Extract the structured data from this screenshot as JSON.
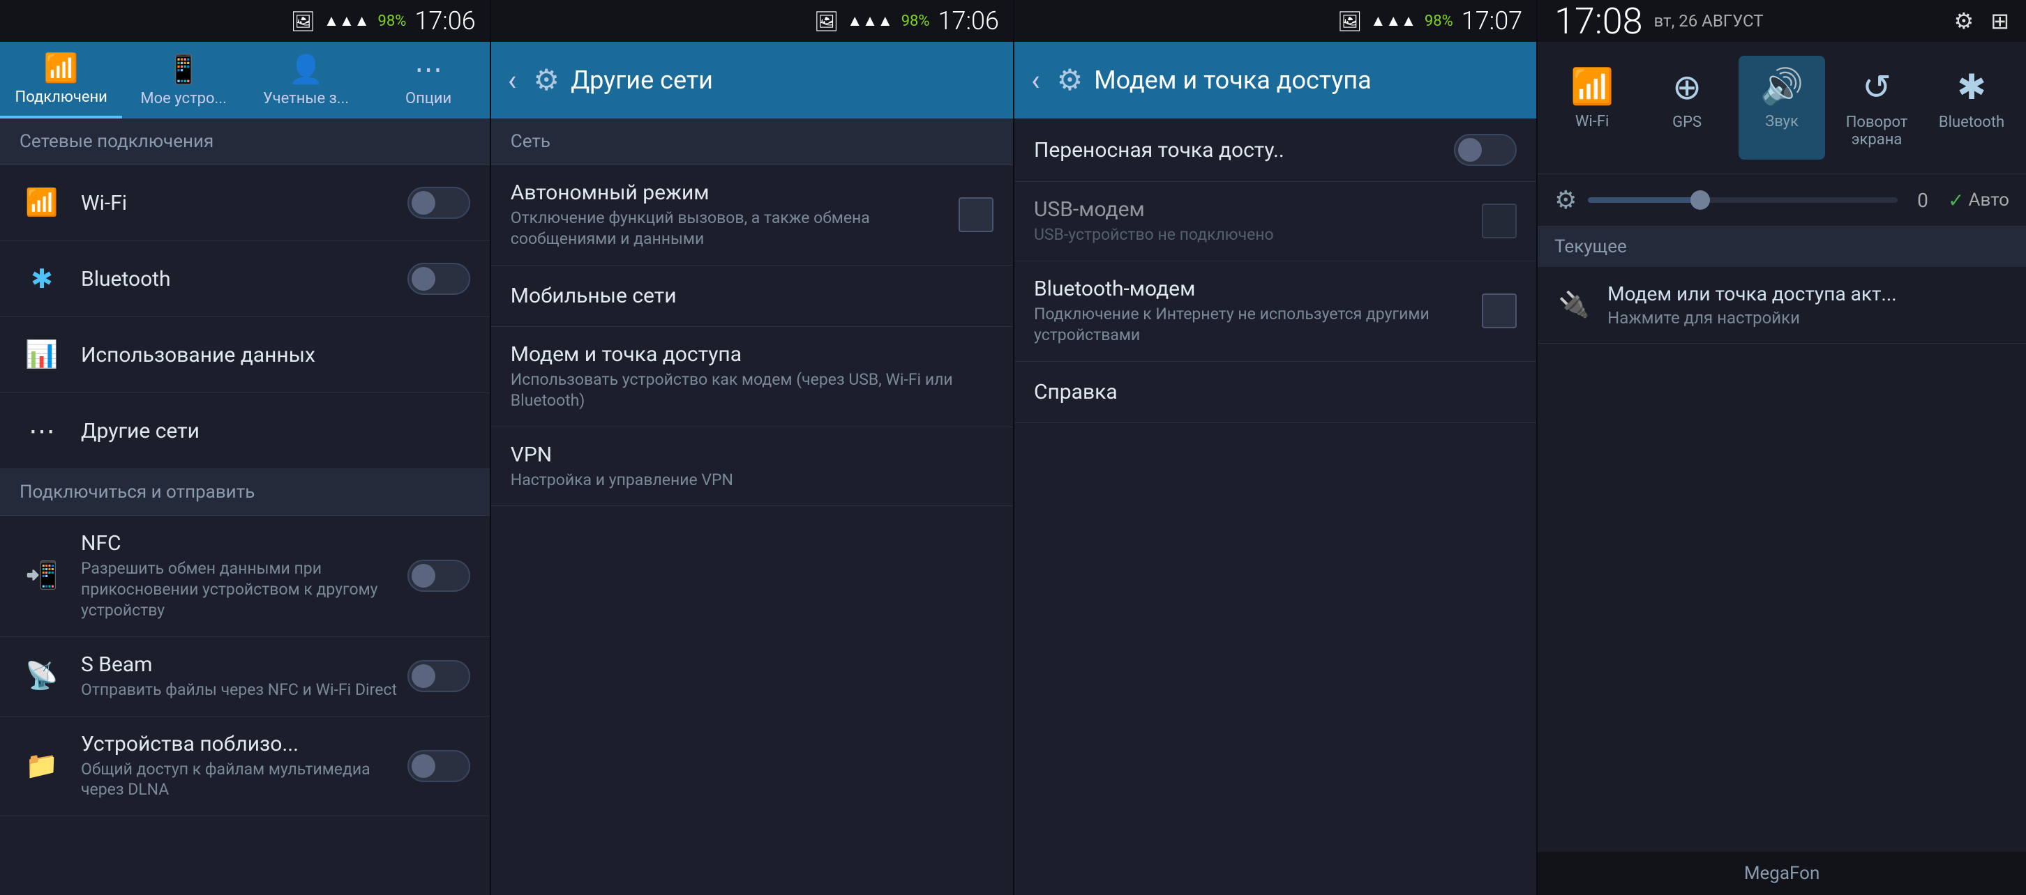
{
  "panel1": {
    "status": {
      "signal": "▲▲▲",
      "battery_pct": "98%",
      "time": "17:06",
      "image_icon": "🖼"
    },
    "tabs": [
      {
        "id": "connections",
        "label": "Подключени",
        "icon": "📶",
        "active": true
      },
      {
        "id": "mydevice",
        "label": "Мое устро...",
        "icon": "📱",
        "active": false
      },
      {
        "id": "accounts",
        "label": "Учетные з...",
        "icon": "👤",
        "active": false
      },
      {
        "id": "options",
        "label": "Опции",
        "icon": "⋯",
        "active": false
      }
    ],
    "section1": "Сетевые подключения",
    "items": [
      {
        "id": "wifi",
        "icon": "📶",
        "title": "Wi-Fi",
        "toggle": true,
        "toggle_state": "off"
      },
      {
        "id": "bluetooth",
        "icon": "🔵",
        "title": "Bluetooth",
        "toggle": true,
        "toggle_state": "off"
      }
    ],
    "section2": "Подключиться и отправить",
    "items2": [
      {
        "id": "data-usage",
        "icon": "📊",
        "title": "Использование данных",
        "toggle": false
      },
      {
        "id": "other-networks",
        "icon": "⋯",
        "title": "Другие сети",
        "toggle": false
      },
      {
        "id": "nfc",
        "icon": "📲",
        "title": "NFC",
        "subtitle": "Разрешить обмен данными при прикосновении устройством к другому устройству",
        "toggle": true,
        "toggle_state": "off"
      },
      {
        "id": "sbeam",
        "icon": "📡",
        "title": "S Beam",
        "subtitle": "Отправить файлы через NFC и Wi-Fi Direct",
        "toggle": true,
        "toggle_state": "off"
      },
      {
        "id": "nearby",
        "icon": "📁",
        "title": "Устройства поблизо...",
        "subtitle": "Общий доступ к файлам мультимедиа через DLNA",
        "toggle": true,
        "toggle_state": "off"
      }
    ]
  },
  "panel2": {
    "status": {
      "signal": "▲▲▲",
      "battery_pct": "98%",
      "time": "17:06",
      "image_icon": "🖼"
    },
    "header": {
      "back": "‹",
      "title": "Другие сети"
    },
    "section_label": "Сеть",
    "items": [
      {
        "id": "airplane",
        "title": "Автономный режим",
        "subtitle": "Отключение функций вызовов, а также обмена сообщениями и данными",
        "has_checkbox": true
      },
      {
        "id": "mobile-networks",
        "title": "Мобильные сети",
        "subtitle": "",
        "has_checkbox": false
      },
      {
        "id": "tethering",
        "title": "Модем и точка доступа",
        "subtitle": "Использовать устройство как модем (через USB, Wi-Fi или Bluetooth)",
        "has_checkbox": false
      },
      {
        "id": "vpn",
        "title": "VPN",
        "subtitle": "Настройка и управление VPN",
        "has_checkbox": false
      }
    ]
  },
  "panel3": {
    "status": {
      "signal": "▲▲▲",
      "battery_pct": "98%",
      "time": "17:07",
      "image_icon": "🖼"
    },
    "header": {
      "back": "‹",
      "title": "Модем и точка доступа"
    },
    "items": [
      {
        "id": "portable-hotspot",
        "title": "Переносная точка досту..",
        "subtitle": "",
        "toggle": true,
        "toggle_state": "off"
      },
      {
        "id": "usb-tethering",
        "title": "USB-модем",
        "subtitle": "USB-устройство не подключено",
        "checkbox": true,
        "checkbox_state": false,
        "disabled": true
      },
      {
        "id": "bluetooth-tethering",
        "title": "Bluetooth-модем",
        "subtitle": "Подключение к Интернету не используется другими устройствами",
        "checkbox": true,
        "checkbox_state": false
      },
      {
        "id": "help",
        "title": "Справка",
        "subtitle": ""
      }
    ]
  },
  "panel4": {
    "status": {
      "time": "17:08",
      "date": "вт, 26 АВГУСТ",
      "gear_icon": "⚙",
      "grid_icon": "⊞"
    },
    "quick_tiles": [
      {
        "id": "wifi",
        "icon": "📶",
        "label": "Wi-Fi",
        "active": false
      },
      {
        "id": "gps",
        "icon": "⊕",
        "label": "GPS",
        "active": false
      },
      {
        "id": "sound",
        "icon": "🔊",
        "label": "Звук",
        "active": true
      },
      {
        "id": "rotate",
        "icon": "↺",
        "label": "Поворот экрана",
        "active": false
      },
      {
        "id": "bluetooth",
        "icon": "✱",
        "label": "Bluetooth",
        "active": false
      }
    ],
    "brightness": {
      "icon": "⚙",
      "value": "0",
      "auto_label": "Авто",
      "auto_checked": true
    },
    "current_section": "Текущее",
    "notifications": [
      {
        "id": "hotspot-notif",
        "icon": "🔌",
        "title": "Модем или точка доступа акт...",
        "subtitle": "Нажмите для настройки"
      }
    ],
    "footer": "MegaFon"
  }
}
